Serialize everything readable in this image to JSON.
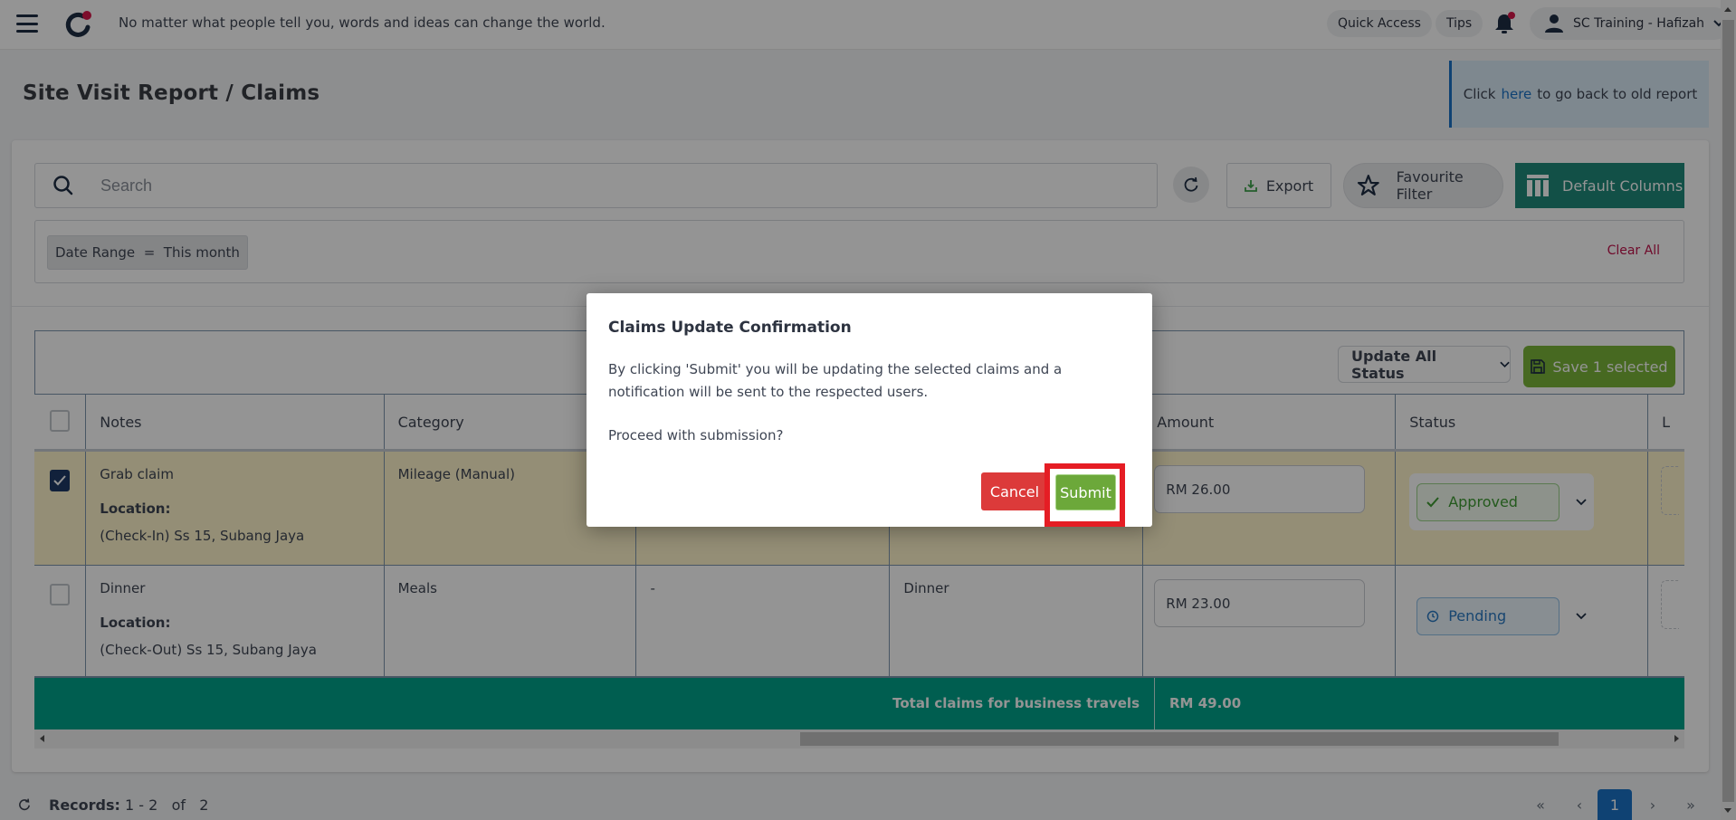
{
  "topbar": {
    "quote": "No matter what people tell you, words and ideas can change the world.",
    "quick_access": "Quick Access",
    "tips": "Tips",
    "user": "SC Training - Hafizah"
  },
  "page": {
    "title": "Site Visit Report / Claims",
    "banner": {
      "prefix": "Click",
      "link": "here",
      "suffix": "to go back to old report"
    }
  },
  "toolbar": {
    "search_placeholder": "Search",
    "search_value": "",
    "export": "Export",
    "favourite_filter": "Favourite Filter",
    "default_columns": "Default Columns"
  },
  "filters": {
    "chip": "Date Range  =  This month",
    "clear_all": "Clear All"
  },
  "table": {
    "update_all_status": "Update All Status",
    "save_selected": "Save 1 selected",
    "columns": [
      "Notes",
      "Category",
      "",
      "",
      "Amount",
      "Status",
      "L"
    ],
    "rows": [
      {
        "checked": true,
        "notes": "Grab claim",
        "location_label": "Location:",
        "location": "(Check-In) Ss 15, Subang Jaya",
        "category": "Mileage (Manual)",
        "col3": "",
        "col4": "",
        "amount": "RM 26.00",
        "status": "Approved"
      },
      {
        "checked": false,
        "notes": "Dinner",
        "location_label": "Location:",
        "location": "(Check-Out) Ss 15, Subang Jaya",
        "category": "Meals",
        "col3": "-",
        "col4": "Dinner",
        "amount": "RM 23.00",
        "status": "Pending"
      }
    ],
    "total_label": "Total claims for business travels",
    "total_value": "RM 49.00"
  },
  "footer": {
    "records_label": "Records:",
    "records_range": "1 - 2",
    "records_of": "of",
    "records_total": "2",
    "pages": [
      "«",
      "‹",
      "1",
      "›",
      "»"
    ],
    "current_page": "1"
  },
  "modal": {
    "title": "Claims Update Confirmation",
    "body": "By clicking 'Submit' you will be updating the selected claims and a notification will be sent to the respected users.",
    "question": "Proceed with submission?",
    "cancel": "Cancel",
    "submit": "Submit"
  },
  "colors": {
    "brand_teal": "#1f8a7a",
    "total_row": "#00a38a",
    "save_green": "#7ab63a",
    "submit_green": "#6ca83a",
    "cancel_red": "#dc3a3a",
    "highlight_red": "#e51d24",
    "link_blue": "#1a73c6",
    "selected_row": "#fff4cc"
  }
}
